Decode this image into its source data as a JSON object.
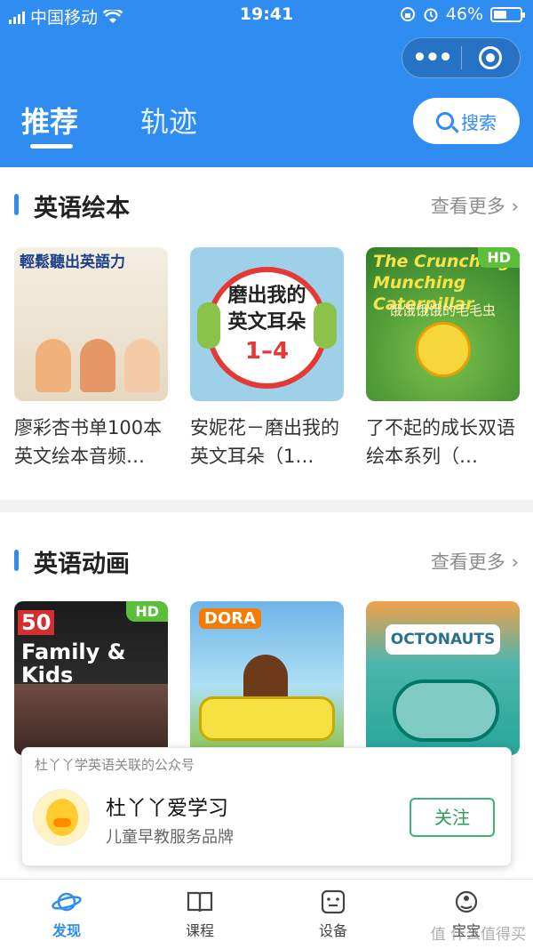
{
  "status_bar": {
    "carrier": "中国移动",
    "time": "19:41",
    "battery": "46%"
  },
  "header": {
    "tabs": [
      {
        "label": "推荐"
      },
      {
        "label": "轨迹"
      }
    ],
    "search_label": "搜索"
  },
  "sections": [
    {
      "title": "英语绘本",
      "more": "查看更多",
      "items": [
        {
          "caption": "廖彩杏书单100本英文绘本音频…",
          "cover_text": "輕鬆聽出英語力"
        },
        {
          "caption": "安妮花－磨出我的英文耳朵（1…",
          "cover_title": "磨出我的英文耳朵",
          "cover_range": "1–4"
        },
        {
          "caption": "了不起的成长双语绘本系列（…",
          "cover_title": "The Crunching Munching Caterpillar",
          "cover_sub": "饿饿饿饿的毛毛虫",
          "badge": "HD"
        }
      ]
    },
    {
      "title": "英语动画",
      "more": "查看更多",
      "items": [
        {
          "cover_num": "50",
          "cover_title": "Family & Kids Movies",
          "badge": "HD"
        },
        {
          "cover_title": "DORA"
        },
        {
          "cover_title": "OCTONAUTS"
        }
      ]
    }
  ],
  "popup": {
    "hint": "杜丫丫学英语关联的公众号",
    "name": "杜丫丫爱学习",
    "desc": "儿童早教服务品牌",
    "follow": "关注"
  },
  "tabbar": [
    {
      "label": "发现",
      "icon": "planet-icon",
      "active": true
    },
    {
      "label": "课程",
      "icon": "book-icon",
      "active": false
    },
    {
      "label": "设备",
      "icon": "device-icon",
      "active": false
    },
    {
      "label": "宝宝",
      "icon": "baby-icon",
      "active": false
    }
  ],
  "watermark": "值 什么值得买",
  "colors": {
    "primary": "#2f8cf0",
    "follow_green": "#3cb371",
    "hd_badge": "#5bbf3a"
  }
}
